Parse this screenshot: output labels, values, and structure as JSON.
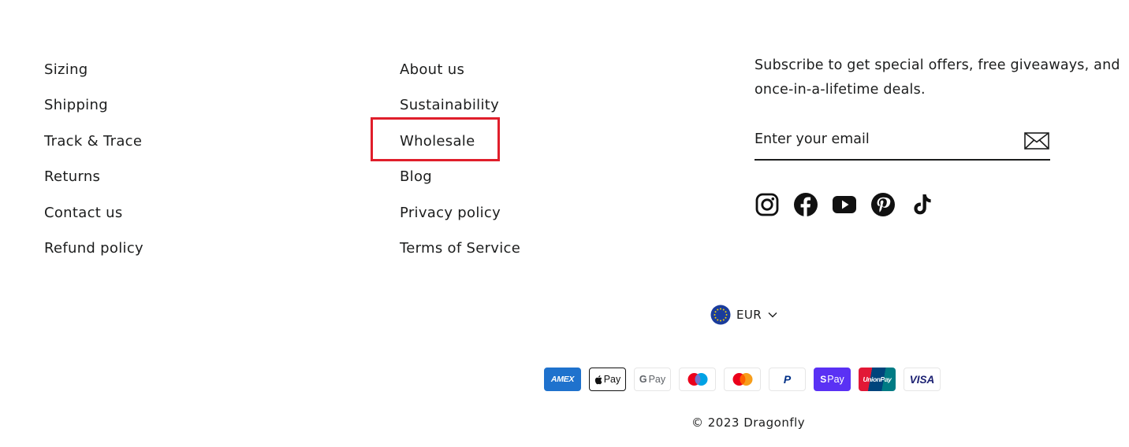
{
  "footer_links_left": [
    {
      "label": "Sizing"
    },
    {
      "label": "Shipping"
    },
    {
      "label": "Track & Trace"
    },
    {
      "label": "Returns"
    },
    {
      "label": "Contact us"
    },
    {
      "label": "Refund policy"
    }
  ],
  "footer_links_middle": [
    {
      "label": "About us"
    },
    {
      "label": "Sustainability"
    },
    {
      "label": "Wholesale"
    },
    {
      "label": "Blog"
    },
    {
      "label": "Privacy policy"
    },
    {
      "label": "Terms of Service"
    }
  ],
  "highlight": {
    "target": "Wholesale",
    "color": "#e01e2b"
  },
  "newsletter": {
    "text": "Subscribe to get special offers, free giveaways, and once-in-a-lifetime deals.",
    "email_placeholder": "Enter your email",
    "submit_icon": "envelope-icon"
  },
  "socials": [
    "instagram-icon",
    "facebook-icon",
    "youtube-icon",
    "pinterest-icon",
    "tiktok-icon"
  ],
  "currency": {
    "code": "EUR",
    "flag_icon": "eu-flag-icon",
    "dropdown_icon": "chevron-down-icon"
  },
  "payment_methods": [
    {
      "name": "American Express",
      "label": "AMEX"
    },
    {
      "name": "Apple Pay",
      "label": "Pay"
    },
    {
      "name": "Google Pay",
      "label": "Pay"
    },
    {
      "name": "Maestro",
      "label": ""
    },
    {
      "name": "Mastercard",
      "label": ""
    },
    {
      "name": "PayPal",
      "label": "P"
    },
    {
      "name": "Shop Pay",
      "label": "Pay"
    },
    {
      "name": "UnionPay",
      "label": "UnionPay"
    },
    {
      "name": "Visa",
      "label": "VISA"
    }
  ],
  "copyright": "© 2023 Dragonfly",
  "colors": {
    "text": "#1c1d1d",
    "highlight": "#e01e2b",
    "amex": "#1f72cd",
    "shoppay": "#5a31f4"
  }
}
